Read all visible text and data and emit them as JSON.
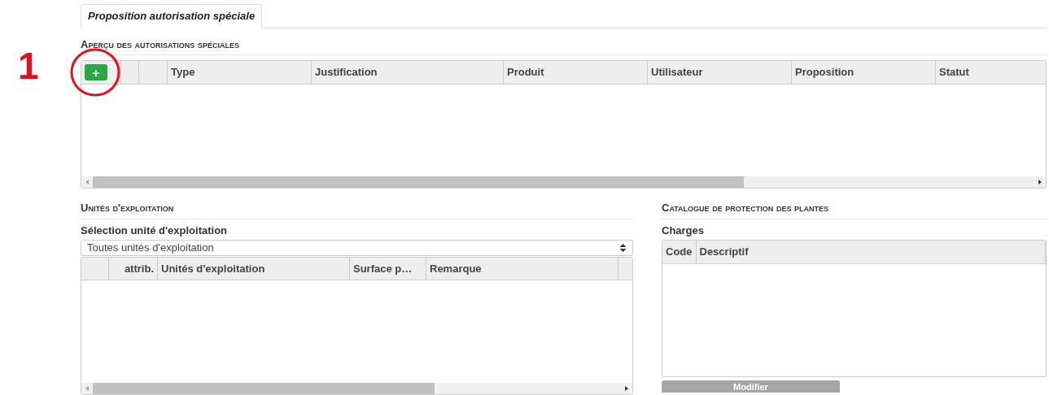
{
  "annotation": {
    "label": "1"
  },
  "tabs": [
    {
      "label": "Proposition autorisation spéciale",
      "selected": true
    }
  ],
  "overview": {
    "heading": "Aperçu des autorisations spéciales",
    "add_button": "+",
    "columns": [
      {
        "kind": "button"
      },
      {
        "kind": "blank"
      },
      {
        "kind": "blank"
      },
      {
        "label": "Type",
        "kind": "text"
      },
      {
        "label": "Justification",
        "kind": "text"
      },
      {
        "label": "Produit",
        "kind": "text"
      },
      {
        "label": "Utilisateur",
        "kind": "text"
      },
      {
        "label": "Proposition",
        "kind": "text"
      },
      {
        "label": "Statut",
        "kind": "text"
      }
    ]
  },
  "units": {
    "heading": "Unités d'exploitation",
    "select_label": "Sélection unité d'exploitation",
    "select_value": "Toutes unités d'exploitation",
    "columns": [
      "attrib.",
      "Unités d'exploitation",
      "Surface p…",
      "Remarque"
    ]
  },
  "catalogue": {
    "heading": "Catalogue de protection des plantes",
    "table_label": "Charges",
    "columns": [
      "Code",
      "Descriptif"
    ],
    "button": {
      "label": "Modifier",
      "disabled": true
    }
  }
}
